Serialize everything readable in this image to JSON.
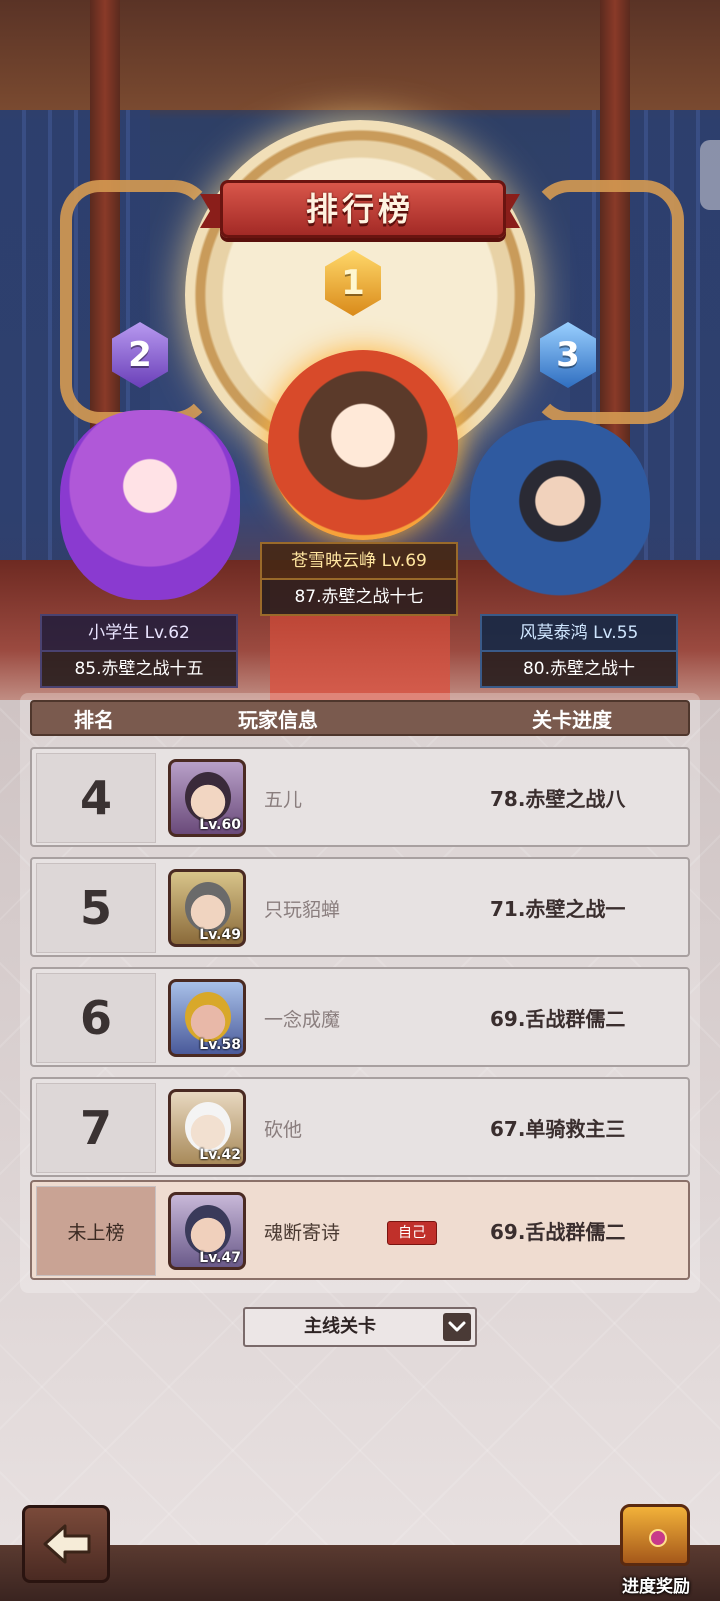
{
  "title": "排行榜",
  "top3": [
    {
      "rank": "1",
      "name": "苍雪映云峥 Lv.69",
      "stage": "87.赤壁之战十七"
    },
    {
      "rank": "2",
      "name": "小学生 Lv.62",
      "stage": "85.赤壁之战十五"
    },
    {
      "rank": "3",
      "name": "风莫泰鸿 Lv.55",
      "stage": "80.赤壁之战十"
    }
  ],
  "table": {
    "headers": {
      "rank": "排名",
      "player": "玩家信息",
      "progress": "关卡进度"
    },
    "rows": [
      {
        "rank": "4",
        "level": "Lv.60",
        "name": "五儿",
        "progress": "78.赤壁之战八"
      },
      {
        "rank": "5",
        "level": "Lv.49",
        "name": "只玩貂蝉",
        "progress": "71.赤壁之战一"
      },
      {
        "rank": "6",
        "level": "Lv.58",
        "name": "一念成魔",
        "progress": "69.舌战群儒二"
      },
      {
        "rank": "7",
        "level": "Lv.42",
        "name": "砍他",
        "progress": "67.单骑救主三"
      }
    ],
    "self": {
      "rank": "未上榜",
      "level": "Lv.47",
      "name": "魂断寄诗",
      "tag": "自己",
      "progress": "69.舌战群儒二"
    }
  },
  "dropdown": {
    "selected": "主线关卡"
  },
  "buttons": {
    "reward_label": "进度奖励",
    "back_icon": "back-arrow-icon"
  },
  "colors": {
    "accent_red": "#c0302a",
    "header_brown": "#7a5a4e",
    "gold": "#f2b23a"
  }
}
